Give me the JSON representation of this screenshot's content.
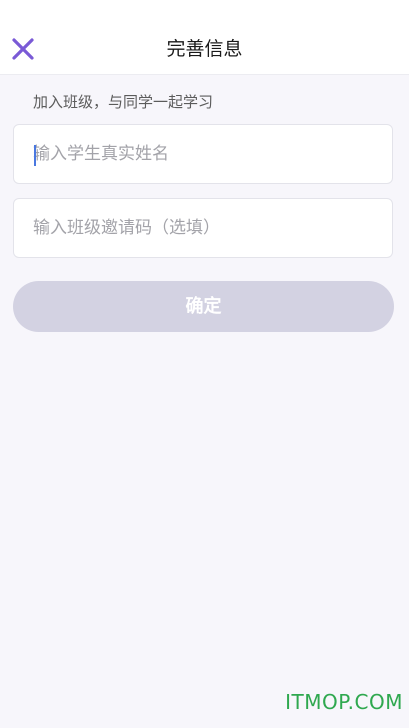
{
  "header": {
    "title": "完善信息",
    "close_icon": "close-icon"
  },
  "form": {
    "hint": "加入班级，与同学一起学习",
    "name_placeholder": "输入学生真实姓名",
    "code_placeholder": "输入班级邀请码（选填）",
    "confirm_label": "确定"
  },
  "colors": {
    "accent": "#7a5ad6",
    "button_disabled": "#d3d2e2",
    "background": "#f7f6fb"
  },
  "watermark": "ITMOP.COM"
}
